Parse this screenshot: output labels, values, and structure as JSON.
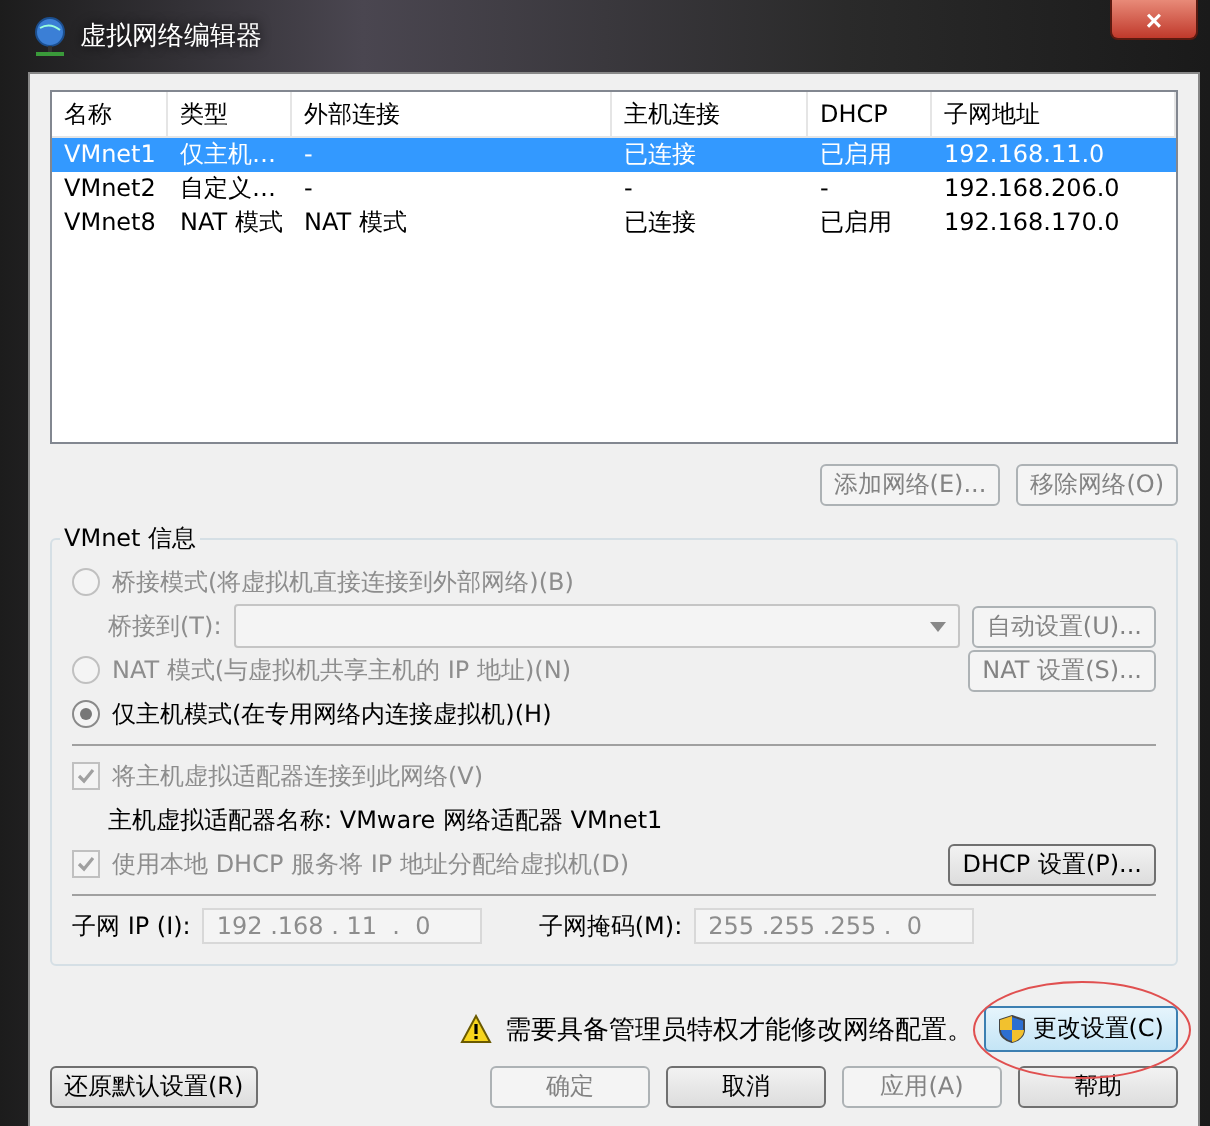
{
  "window": {
    "title": "虚拟网络编辑器",
    "close": "×"
  },
  "table": {
    "columns": [
      "名称",
      "类型",
      "外部连接",
      "主机连接",
      "DHCP",
      "子网地址"
    ],
    "rows": [
      {
        "cells": [
          "VMnet1",
          "仅主机…",
          "-",
          "已连接",
          "已启用",
          "192.168.11.0"
        ],
        "selected": true
      },
      {
        "cells": [
          "VMnet2",
          "自定义…",
          "-",
          "-",
          "-",
          "192.168.206.0"
        ],
        "selected": false
      },
      {
        "cells": [
          "VMnet8",
          "NAT 模式",
          "NAT 模式",
          "已连接",
          "已启用",
          "192.168.170.0"
        ],
        "selected": false
      }
    ]
  },
  "table_buttons": [
    {
      "label": "添加网络(E)...",
      "disabled": true
    },
    {
      "label": "移除网络(O)",
      "disabled": true
    }
  ],
  "vmnet_info": {
    "title": "VMnet 信息",
    "bridge": {
      "label": "桥接模式(将虚拟机直接连接到外部网络)(B)",
      "selected": false,
      "disabled": true
    },
    "bridge_to": {
      "label": "桥接到(T):",
      "button": "自动设置(U)...",
      "disabled": true
    },
    "nat": {
      "label": "NAT 模式(与虚拟机共享主机的 IP 地址)(N)",
      "selected": false,
      "disabled": true,
      "button": "NAT 设置(S)..."
    },
    "host_only": {
      "label": "仅主机模式(在专用网络内连接虚拟机)(H)",
      "selected": true,
      "disabled": false
    },
    "connect_adapter": {
      "label": "将主机虚拟适配器连接到此网络(V)",
      "checked": true,
      "disabled": true
    },
    "adapter_name": "主机虚拟适配器名称: VMware 网络适配器 VMnet1",
    "use_dhcp": {
      "label": "使用本地 DHCP 服务将 IP 地址分配给虚拟机(D)",
      "checked": true,
      "disabled": true
    },
    "dhcp_button": {
      "label": "DHCP 设置(P)...",
      "disabled": false
    },
    "subnet_ip": {
      "label": "子网 IP (I):",
      "value": "192 .168 . 11  .  0"
    },
    "subnet_mask": {
      "label": "子网掩码(M):",
      "value": "255 .255 .255 .  0"
    }
  },
  "warning": {
    "text": "需要具备管理员特权才能修改网络配置。",
    "button": "更改设置(C)"
  },
  "bottom_buttons": [
    {
      "label": "还原默认设置(R)",
      "disabled": false
    },
    {
      "label": "确定",
      "disabled": true
    },
    {
      "label": "取消",
      "disabled": false
    },
    {
      "label": "应用(A)",
      "disabled": true
    },
    {
      "label": "帮助",
      "disabled": false
    }
  ]
}
